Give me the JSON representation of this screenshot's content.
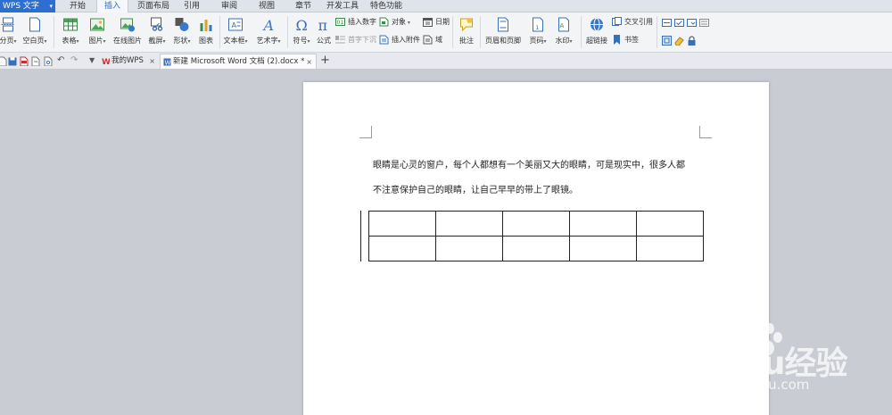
{
  "app": {
    "name": "WPS 文字"
  },
  "menu_tabs": [
    "开始",
    "插入",
    "页面布局",
    "引用",
    "审阅",
    "视图",
    "章节",
    "开发工具",
    "特色功能"
  ],
  "active_menu_tab": "插入",
  "ribbon": {
    "page_break": "分页",
    "blank_page": "空白页",
    "table": "表格",
    "picture": "图片",
    "online_picture": "在线图片",
    "screenshot": "截屏",
    "shape": "形状",
    "chart": "图表",
    "textbox": "文本框",
    "wordart": "艺术字",
    "symbol": "符号",
    "formula": "公式",
    "insert_number": "插入数字",
    "drop_cap": "首字下沉",
    "object": "对象",
    "insert_attachment": "插入附件",
    "date": "日期",
    "field": "域",
    "comment": "批注",
    "header_footer": "页眉和页脚",
    "page_number": "页码",
    "watermark": "水印",
    "hyperlink": "超链接",
    "cross_reference": "交叉引用",
    "bookmark": "书签"
  },
  "doc_tabs": [
    {
      "label": "我的WPS"
    },
    {
      "label": "新建 Microsoft Word 文档 (2).docx *"
    }
  ],
  "document": {
    "line1": "眼睛是心灵的窗户，每个人都想有一个美丽又大的眼睛，可是现实中，很多人都",
    "line2": "不注意保护自己的眼睛，让自己早早的带上了眼镜。",
    "table_rows": 2,
    "table_cols": 5
  },
  "watermark": {
    "brand": "Baidu经验",
    "url": "jingyan.baidu.com"
  },
  "colors": {
    "accent": "#2d6fd0",
    "workspace": "#c9ccd3",
    "ribbon": "#f3f4f6"
  }
}
